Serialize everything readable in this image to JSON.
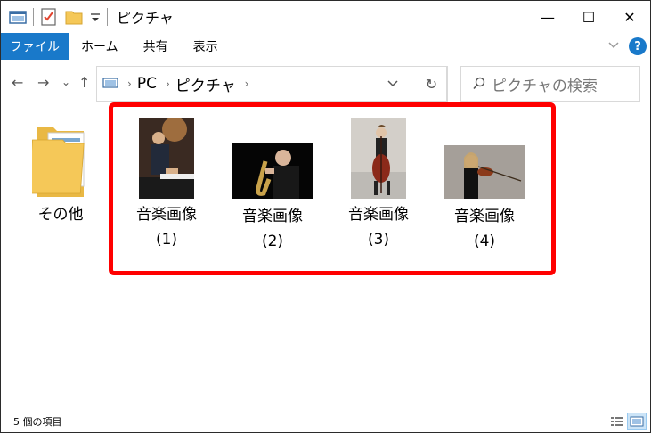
{
  "window": {
    "title": "ピクチャ",
    "controls": {
      "minimize": "—",
      "maximize": "☐",
      "close": "✕"
    }
  },
  "ribbon": {
    "tabs": [
      "ファイル",
      "ホーム",
      "共有",
      "表示"
    ],
    "help": "?"
  },
  "nav": {
    "back": "←",
    "forward": "→",
    "recent": "⌄",
    "up": "↑",
    "breadcrumb": [
      "PC",
      "ピクチャ"
    ],
    "refresh": "↻",
    "search_placeholder": "ピクチャの検索"
  },
  "items": [
    {
      "name": "その他",
      "type": "folder"
    },
    {
      "name": "音楽画像",
      "index": "(1)",
      "type": "image",
      "subject": "piano"
    },
    {
      "name": "音楽画像",
      "index": "(2)",
      "type": "image",
      "subject": "saxophone"
    },
    {
      "name": "音楽画像",
      "index": "(3)",
      "type": "image",
      "subject": "cello"
    },
    {
      "name": "音楽画像",
      "index": "(4)",
      "type": "image",
      "subject": "violin"
    }
  ],
  "status": {
    "item_count": "5 個の項目"
  },
  "colors": {
    "accent": "#1979ca",
    "highlight_box": "#ff0000",
    "folder": "#f5c858"
  }
}
